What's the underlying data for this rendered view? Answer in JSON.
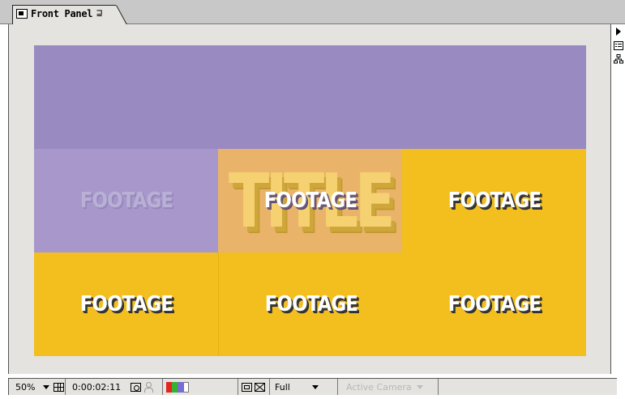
{
  "panel": {
    "tab_title": "Front Panel",
    "tab_menu_glyph": "⊒"
  },
  "composition": {
    "title_text": "TITLE",
    "footage_label": "FOOTAGE",
    "colors": {
      "purple_band": "#9a8ac2",
      "yellow": "#f2bf1f",
      "title_overlay": "#e9b46a",
      "ghost_cell": "#a897cb"
    }
  },
  "toolbar": {
    "magnification": "50%",
    "timecode": "0:00:02:11",
    "resolution": "Full",
    "camera": "Active Camera",
    "channel_swatches": [
      "#e5231f",
      "#34b233",
      "#7a6cd0",
      "#ffffff"
    ]
  },
  "icons": {
    "tab": "composition-icon",
    "rail": [
      "flyout-arrow-icon",
      "list-view-icon",
      "flowchart-icon"
    ],
    "toolbar": [
      "safe-zones-icon",
      "snapshot-icon",
      "show-snapshot-icon",
      "channels-icon",
      "region-of-interest-icon",
      "transparency-grid-icon"
    ]
  }
}
